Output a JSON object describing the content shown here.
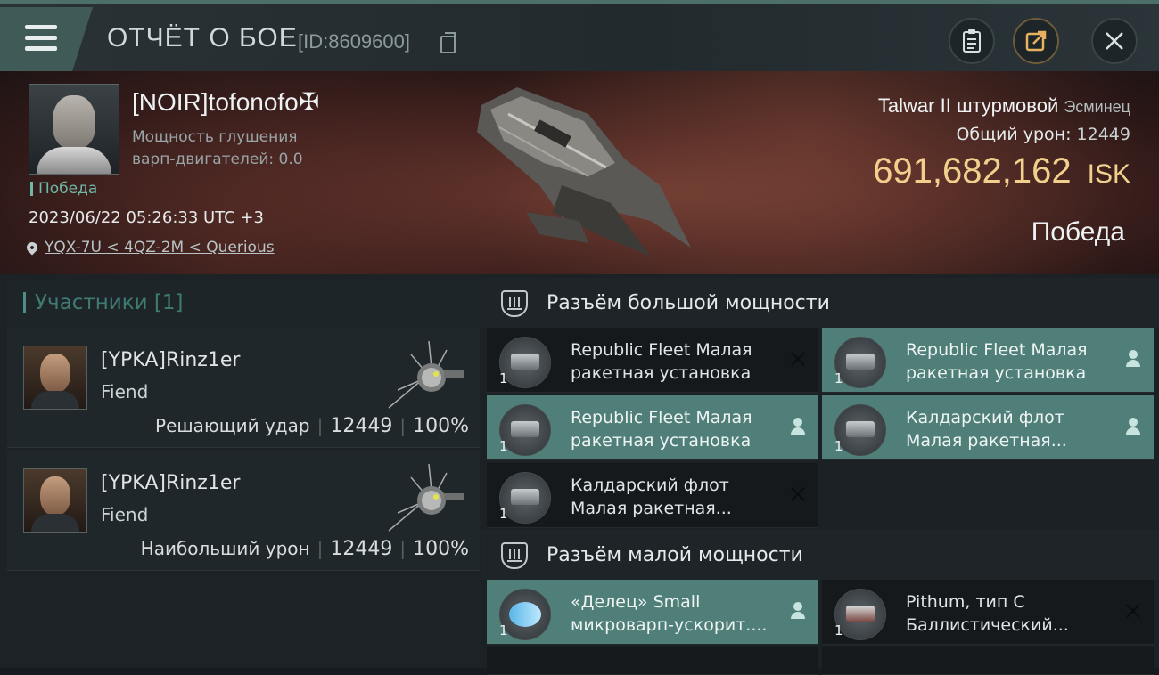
{
  "header": {
    "title": "ОТЧЁТ О БОЕ",
    "report_id": "[ID:8609600]",
    "icons": [
      "menu-icon",
      "copy-icon",
      "clipboard-icon",
      "share-icon",
      "close-icon"
    ]
  },
  "victim": {
    "name": "[NOIR]tofonofo✠",
    "info_line1": "Мощность глушения",
    "info_line2": "варп-двигателей: 0.0",
    "tag": "Победа",
    "datetime": "2023/06/22 05:26:33 UTC +3",
    "location": "YQX-7U < 4QZ-2M < Querious"
  },
  "ship": {
    "name": "Talwar II штурмовой",
    "class": "Эсминец",
    "total_damage_label": "Общий урон:",
    "total_damage": "12449",
    "value": "691,682,162",
    "currency": "ISK",
    "result": "Победа"
  },
  "participants": {
    "label": "Участники [1]",
    "cards": [
      {
        "name": "[YPKA]Rinz1er",
        "ship": "Fiend",
        "role": "Решающий удар",
        "damage": "12449",
        "percent": "100%"
      },
      {
        "name": "[YPKA]Rinz1er",
        "ship": "Fiend",
        "role": "Наибольший урон",
        "damage": "12449",
        "percent": "100%"
      }
    ]
  },
  "fittings": {
    "high": {
      "label": "Разъём большой мощности",
      "items": [
        {
          "line1": "Republic Fleet Малая",
          "line2": "ракетная установка",
          "qty": "1",
          "status": "destroyed"
        },
        {
          "line1": "Republic Fleet Малая",
          "line2": "ракетная установка",
          "qty": "1",
          "status": "dropped"
        },
        {
          "line1": "Republic Fleet Малая",
          "line2": "ракетная установка",
          "qty": "1",
          "status": "dropped"
        },
        {
          "line1": "Калдарский флот",
          "line2": "Малая ракетная...",
          "qty": "1",
          "status": "dropped"
        },
        {
          "line1": "Калдарский флот",
          "line2": "Малая ракетная...",
          "qty": "1",
          "status": "destroyed"
        }
      ]
    },
    "low": {
      "label": "Разъём малой мощности",
      "items": [
        {
          "line1": "«Делец» Small",
          "line2": "микроварп-ускорит....",
          "qty": "1",
          "status": "dropped"
        },
        {
          "line1": "Pithum, тип C",
          "line2": "Баллистический...",
          "qty": "1",
          "status": "destroyed"
        }
      ]
    }
  },
  "colors": {
    "accent": "#4f7f78",
    "isk": "#f1d08e",
    "victory": "#6fb7a6"
  }
}
